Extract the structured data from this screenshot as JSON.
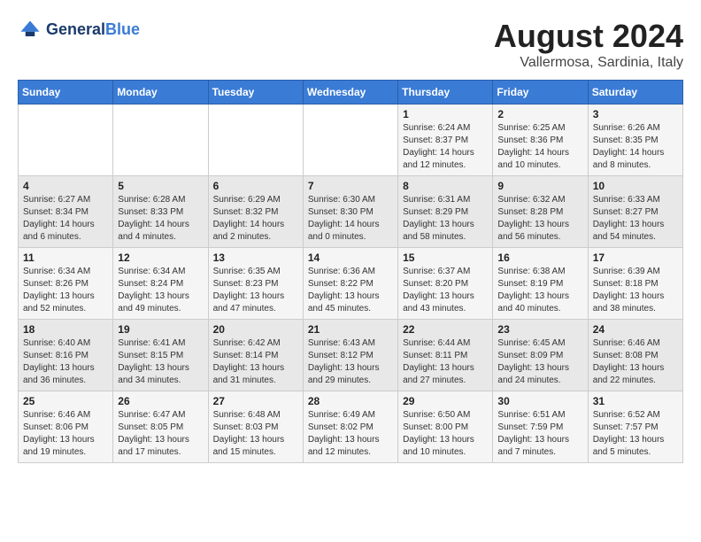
{
  "header": {
    "logo_general": "General",
    "logo_blue": "Blue",
    "month_title": "August 2024",
    "subtitle": "Vallermosa, Sardinia, Italy"
  },
  "weekdays": [
    "Sunday",
    "Monday",
    "Tuesday",
    "Wednesday",
    "Thursday",
    "Friday",
    "Saturday"
  ],
  "weeks": [
    [
      {
        "day": "",
        "info": ""
      },
      {
        "day": "",
        "info": ""
      },
      {
        "day": "",
        "info": ""
      },
      {
        "day": "",
        "info": ""
      },
      {
        "day": "1",
        "info": "Sunrise: 6:24 AM\nSunset: 8:37 PM\nDaylight: 14 hours\nand 12 minutes."
      },
      {
        "day": "2",
        "info": "Sunrise: 6:25 AM\nSunset: 8:36 PM\nDaylight: 14 hours\nand 10 minutes."
      },
      {
        "day": "3",
        "info": "Sunrise: 6:26 AM\nSunset: 8:35 PM\nDaylight: 14 hours\nand 8 minutes."
      }
    ],
    [
      {
        "day": "4",
        "info": "Sunrise: 6:27 AM\nSunset: 8:34 PM\nDaylight: 14 hours\nand 6 minutes."
      },
      {
        "day": "5",
        "info": "Sunrise: 6:28 AM\nSunset: 8:33 PM\nDaylight: 14 hours\nand 4 minutes."
      },
      {
        "day": "6",
        "info": "Sunrise: 6:29 AM\nSunset: 8:32 PM\nDaylight: 14 hours\nand 2 minutes."
      },
      {
        "day": "7",
        "info": "Sunrise: 6:30 AM\nSunset: 8:30 PM\nDaylight: 14 hours\nand 0 minutes."
      },
      {
        "day": "8",
        "info": "Sunrise: 6:31 AM\nSunset: 8:29 PM\nDaylight: 13 hours\nand 58 minutes."
      },
      {
        "day": "9",
        "info": "Sunrise: 6:32 AM\nSunset: 8:28 PM\nDaylight: 13 hours\nand 56 minutes."
      },
      {
        "day": "10",
        "info": "Sunrise: 6:33 AM\nSunset: 8:27 PM\nDaylight: 13 hours\nand 54 minutes."
      }
    ],
    [
      {
        "day": "11",
        "info": "Sunrise: 6:34 AM\nSunset: 8:26 PM\nDaylight: 13 hours\nand 52 minutes."
      },
      {
        "day": "12",
        "info": "Sunrise: 6:34 AM\nSunset: 8:24 PM\nDaylight: 13 hours\nand 49 minutes."
      },
      {
        "day": "13",
        "info": "Sunrise: 6:35 AM\nSunset: 8:23 PM\nDaylight: 13 hours\nand 47 minutes."
      },
      {
        "day": "14",
        "info": "Sunrise: 6:36 AM\nSunset: 8:22 PM\nDaylight: 13 hours\nand 45 minutes."
      },
      {
        "day": "15",
        "info": "Sunrise: 6:37 AM\nSunset: 8:20 PM\nDaylight: 13 hours\nand 43 minutes."
      },
      {
        "day": "16",
        "info": "Sunrise: 6:38 AM\nSunset: 8:19 PM\nDaylight: 13 hours\nand 40 minutes."
      },
      {
        "day": "17",
        "info": "Sunrise: 6:39 AM\nSunset: 8:18 PM\nDaylight: 13 hours\nand 38 minutes."
      }
    ],
    [
      {
        "day": "18",
        "info": "Sunrise: 6:40 AM\nSunset: 8:16 PM\nDaylight: 13 hours\nand 36 minutes."
      },
      {
        "day": "19",
        "info": "Sunrise: 6:41 AM\nSunset: 8:15 PM\nDaylight: 13 hours\nand 34 minutes."
      },
      {
        "day": "20",
        "info": "Sunrise: 6:42 AM\nSunset: 8:14 PM\nDaylight: 13 hours\nand 31 minutes."
      },
      {
        "day": "21",
        "info": "Sunrise: 6:43 AM\nSunset: 8:12 PM\nDaylight: 13 hours\nand 29 minutes."
      },
      {
        "day": "22",
        "info": "Sunrise: 6:44 AM\nSunset: 8:11 PM\nDaylight: 13 hours\nand 27 minutes."
      },
      {
        "day": "23",
        "info": "Sunrise: 6:45 AM\nSunset: 8:09 PM\nDaylight: 13 hours\nand 24 minutes."
      },
      {
        "day": "24",
        "info": "Sunrise: 6:46 AM\nSunset: 8:08 PM\nDaylight: 13 hours\nand 22 minutes."
      }
    ],
    [
      {
        "day": "25",
        "info": "Sunrise: 6:46 AM\nSunset: 8:06 PM\nDaylight: 13 hours\nand 19 minutes."
      },
      {
        "day": "26",
        "info": "Sunrise: 6:47 AM\nSunset: 8:05 PM\nDaylight: 13 hours\nand 17 minutes."
      },
      {
        "day": "27",
        "info": "Sunrise: 6:48 AM\nSunset: 8:03 PM\nDaylight: 13 hours\nand 15 minutes."
      },
      {
        "day": "28",
        "info": "Sunrise: 6:49 AM\nSunset: 8:02 PM\nDaylight: 13 hours\nand 12 minutes."
      },
      {
        "day": "29",
        "info": "Sunrise: 6:50 AM\nSunset: 8:00 PM\nDaylight: 13 hours\nand 10 minutes."
      },
      {
        "day": "30",
        "info": "Sunrise: 6:51 AM\nSunset: 7:59 PM\nDaylight: 13 hours\nand 7 minutes."
      },
      {
        "day": "31",
        "info": "Sunrise: 6:52 AM\nSunset: 7:57 PM\nDaylight: 13 hours\nand 5 minutes."
      }
    ]
  ]
}
